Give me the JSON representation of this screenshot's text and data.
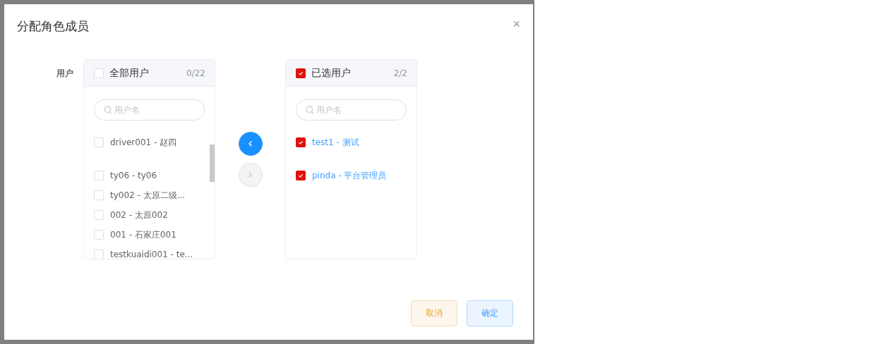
{
  "dialog": {
    "title": "分配角色成员",
    "close": "×"
  },
  "field_label": "用户",
  "panels": [
    {
      "title": "全部用户",
      "count": "0/22",
      "checked": false,
      "placeholder": "用户名",
      "items": [
        {
          "label": "driver001 - 赵四",
          "checked": false
        },
        {
          "label": "ty06 - ty06",
          "checked": false
        },
        {
          "label": "ty002 - 太原二级...",
          "checked": false
        },
        {
          "label": "002 - 太原002",
          "checked": false
        },
        {
          "label": "001 - 石家庄001",
          "checked": false
        },
        {
          "label": "testkuaidi001 - te...",
          "checked": false
        }
      ]
    },
    {
      "title": "已选用户",
      "count": "2/2",
      "checked": true,
      "placeholder": "用户名",
      "items": [
        {
          "label": "test1 - 测试",
          "checked": true
        },
        {
          "label": "pinda - 平台管理员",
          "checked": true
        }
      ]
    }
  ],
  "transfer_buttons": [
    {
      "glyph": "‹",
      "disabled": false
    },
    {
      "glyph": "›",
      "disabled": true
    }
  ],
  "footer": [
    {
      "label": "取消",
      "kind": "warning"
    },
    {
      "label": "确定",
      "kind": "primary"
    }
  ]
}
